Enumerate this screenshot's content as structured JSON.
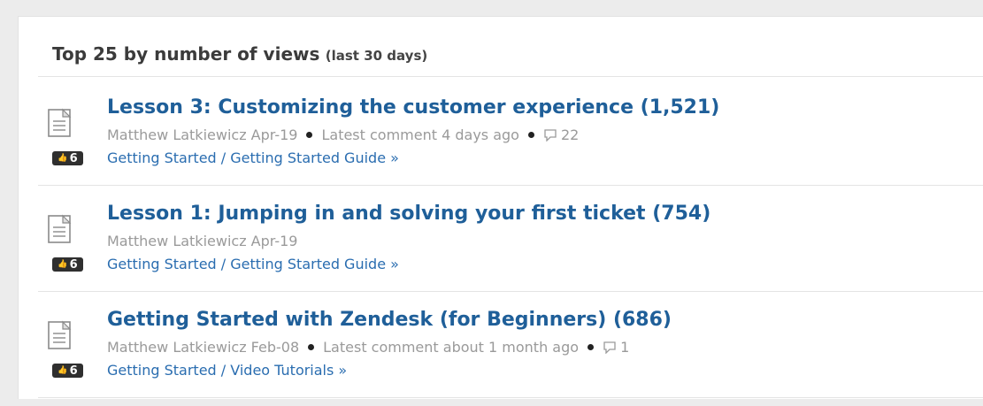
{
  "widget": {
    "title": "Top 25 by number of views",
    "title_suffix": "(last 30 days)"
  },
  "items": [
    {
      "title": "Lesson 3: Customizing the customer experience (1,521)",
      "author_date": "Matthew Latkiewicz Apr-19",
      "latest_comment": "Latest comment 4 days ago",
      "comment_count": "22",
      "breadcrumb": "Getting Started / Getting Started Guide »",
      "votes": "6"
    },
    {
      "title": "Lesson 1: Jumping in and solving your first ticket (754)",
      "author_date": "Matthew Latkiewicz Apr-19",
      "breadcrumb": "Getting Started / Getting Started Guide »",
      "votes": "6"
    },
    {
      "title": "Getting Started with Zendesk (for Beginners) (686)",
      "author_date": "Matthew Latkiewicz Feb-08",
      "latest_comment": "Latest comment about 1 month ago",
      "comment_count": "1",
      "breadcrumb": "Getting Started / Video Tutorials »",
      "votes": "6"
    }
  ]
}
